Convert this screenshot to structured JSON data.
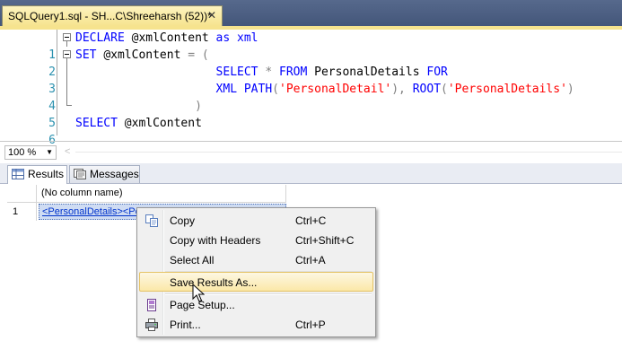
{
  "document_tab": {
    "title": "SQLQuery1.sql - SH...C\\Shreeharsh (52))*",
    "close_glyph": "✕"
  },
  "editor": {
    "lines": [
      {
        "num": "1",
        "tokens": [
          [
            "kw",
            "DECLARE "
          ],
          [
            "id",
            "@xmlContent "
          ],
          [
            "kw",
            "as "
          ],
          [
            "kw",
            "xml"
          ]
        ]
      },
      {
        "num": "2",
        "tokens": [
          [
            "kw",
            "SET "
          ],
          [
            "id",
            "@xmlContent "
          ],
          [
            "op",
            "= ("
          ]
        ]
      },
      {
        "num": "3",
        "tokens": [
          [
            "id",
            "                    "
          ],
          [
            "kw",
            "SELECT "
          ],
          [
            "op",
            "* "
          ],
          [
            "kw",
            "FROM "
          ],
          [
            "id",
            "PersonalDetails "
          ],
          [
            "kw",
            "FOR"
          ]
        ]
      },
      {
        "num": "4",
        "tokens": [
          [
            "id",
            "                    "
          ],
          [
            "kw",
            "XML PATH"
          ],
          [
            "op",
            "("
          ],
          [
            "str",
            "'PersonalDetail'"
          ],
          [
            "op",
            "), "
          ],
          [
            "kw",
            "ROOT"
          ],
          [
            "op",
            "("
          ],
          [
            "str",
            "'PersonalDetails'"
          ],
          [
            "op",
            ")"
          ]
        ]
      },
      {
        "num": "5",
        "tokens": [
          [
            "id",
            "                 "
          ],
          [
            "op",
            ")"
          ]
        ]
      },
      {
        "num": "6",
        "tokens": [
          [
            "kw",
            "SELECT "
          ],
          [
            "id",
            "@xmlContent"
          ]
        ]
      }
    ],
    "zoom": "100 %"
  },
  "results_tabs": {
    "results_label": "Results",
    "messages_label": "Messages"
  },
  "grid": {
    "column_header": "(No column name)",
    "row_number": "1",
    "cell_value": "<PersonalDetails><PersonalDetail><Fi"
  },
  "context_menu": {
    "items": [
      {
        "label": "Copy",
        "shortcut": "Ctrl+C",
        "icon": "copy-icon"
      },
      {
        "label": "Copy with Headers",
        "shortcut": "Ctrl+Shift+C",
        "icon": ""
      },
      {
        "label": "Select All",
        "shortcut": "Ctrl+A",
        "icon": ""
      },
      {
        "label": "Save Results As...",
        "shortcut": "",
        "icon": "",
        "hover": true
      },
      {
        "label": "Page Setup...",
        "shortcut": "",
        "icon": "page-setup-icon"
      },
      {
        "label": "Print...",
        "shortcut": "Ctrl+P",
        "icon": "printer-icon"
      }
    ]
  },
  "colors": {
    "keyword": "#0000ff",
    "string": "#ff0000",
    "operator": "#808080",
    "line_number": "#2b91af",
    "tab_gold": "#f6e38e",
    "tabstrip": "#4d6082"
  }
}
